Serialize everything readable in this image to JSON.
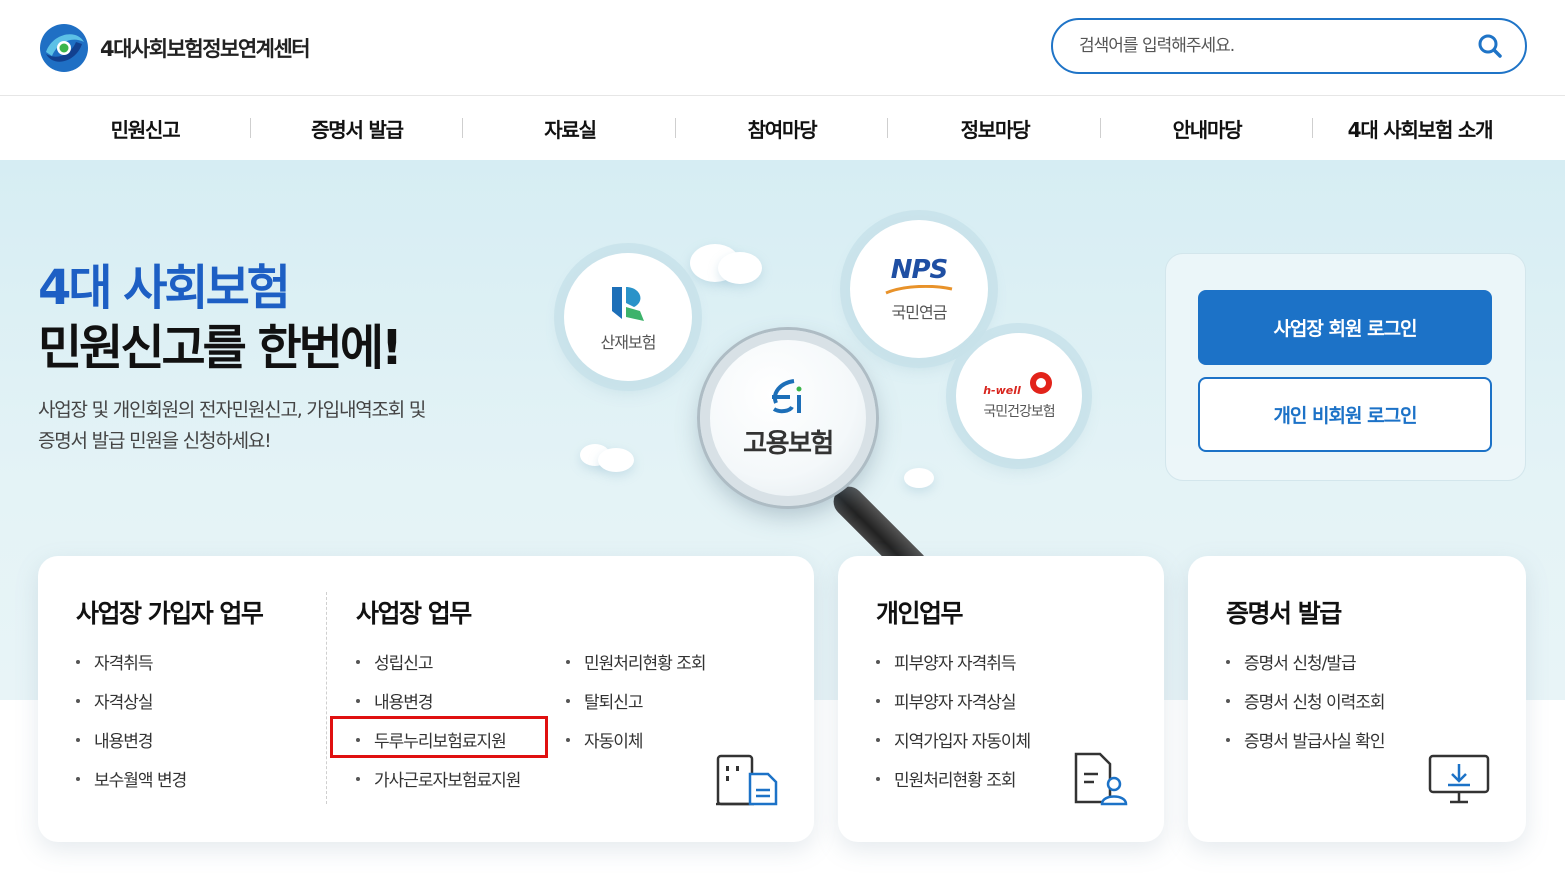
{
  "header": {
    "logo_text": "4대사회보험정보연계센터",
    "search_placeholder": "검색어를 입력해주세요."
  },
  "nav": [
    {
      "label": "민원신고"
    },
    {
      "label": "증명서 발급"
    },
    {
      "label": "자료실"
    },
    {
      "label": "참여마당"
    },
    {
      "label": "정보마당"
    },
    {
      "label": "안내마당"
    },
    {
      "label": "4대 사회보험 소개"
    }
  ],
  "hero": {
    "title_line1": "4대 사회보험",
    "title_line2": "민원신고를 한번에!",
    "desc_line1": "사업장 및 개인회원의 전자민원신고, 가입내역조회 및",
    "desc_line2": "증명서 발급 민원을 신청하세요!",
    "badges": {
      "industrial": "산재보험",
      "nps_logo": "NPS",
      "nps_label": "국민연금",
      "employment": "고용보험",
      "health_logo": "h-well",
      "health_label": "국민건강보험"
    }
  },
  "login": {
    "business_login": "사업장 회원 로그인",
    "personal_login": "개인 비회원 로그인"
  },
  "cards": {
    "business_member": {
      "title": "사업장 가입자 업무",
      "items": [
        "자격취득",
        "자격상실",
        "내용변경",
        "보수월액 변경"
      ]
    },
    "business": {
      "title": "사업장 업무",
      "col1": [
        "성립신고",
        "내용변경",
        "두루누리보험료지원",
        "가사근로자보험료지원"
      ],
      "col2": [
        "민원처리현황 조회",
        "탈퇴신고",
        "자동이체"
      ]
    },
    "personal": {
      "title": "개인업무",
      "items": [
        "피부양자 자격취득",
        "피부양자 자격상실",
        "지역가입자 자동이체",
        "민원처리현황 조회"
      ]
    },
    "certificate": {
      "title": "증명서 발급",
      "items": [
        "증명서 신청/발급",
        "증명서 신청 이력조회",
        "증명서 발급사실 확인"
      ]
    }
  },
  "colors": {
    "brand_blue": "#1c72c7",
    "title_blue": "#1d5fc4",
    "highlight_red": "#e01010"
  }
}
